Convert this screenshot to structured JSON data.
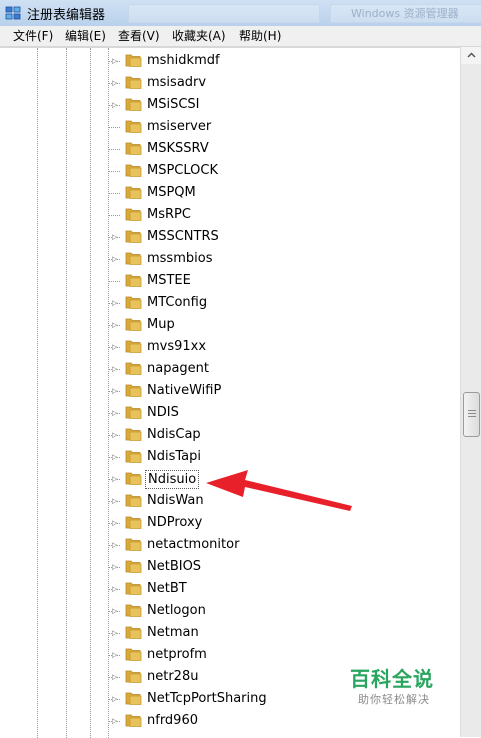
{
  "window": {
    "title": "注册表编辑器",
    "background_tabs": [
      "",
      "Windows 资源管理器"
    ]
  },
  "menu": [
    {
      "label": "文件(F)",
      "name": "menu-file"
    },
    {
      "label": "编辑(E)",
      "name": "menu-edit"
    },
    {
      "label": "查看(V)",
      "name": "menu-view"
    },
    {
      "label": "收藏夹(A)",
      "name": "menu-favorites"
    },
    {
      "label": "帮助(H)",
      "name": "menu-help"
    }
  ],
  "tree": {
    "items": [
      {
        "label": "mshidkmdf",
        "expandable": true
      },
      {
        "label": "msisadrv",
        "expandable": true
      },
      {
        "label": "MSiSCSI",
        "expandable": true
      },
      {
        "label": "msiserver",
        "expandable": false
      },
      {
        "label": "MSKSSRV",
        "expandable": false
      },
      {
        "label": "MSPCLOCK",
        "expandable": false
      },
      {
        "label": "MSPQM",
        "expandable": false
      },
      {
        "label": "MsRPC",
        "expandable": false
      },
      {
        "label": "MSSCNTRS",
        "expandable": true
      },
      {
        "label": "mssmbios",
        "expandable": true
      },
      {
        "label": "MSTEE",
        "expandable": false
      },
      {
        "label": "MTConfig",
        "expandable": true
      },
      {
        "label": "Mup",
        "expandable": true
      },
      {
        "label": "mvs91xx",
        "expandable": true
      },
      {
        "label": "napagent",
        "expandable": true
      },
      {
        "label": "NativeWifiP",
        "expandable": true
      },
      {
        "label": "NDIS",
        "expandable": true
      },
      {
        "label": "NdisCap",
        "expandable": true
      },
      {
        "label": "NdisTapi",
        "expandable": true
      },
      {
        "label": "Ndisuio",
        "expandable": true,
        "selected": true
      },
      {
        "label": "NdisWan",
        "expandable": true
      },
      {
        "label": "NDProxy",
        "expandable": true
      },
      {
        "label": "netactmonitor",
        "expandable": true
      },
      {
        "label": "NetBIOS",
        "expandable": true
      },
      {
        "label": "NetBT",
        "expandable": true
      },
      {
        "label": "Netlogon",
        "expandable": true
      },
      {
        "label": "Netman",
        "expandable": true
      },
      {
        "label": "netprofm",
        "expandable": true
      },
      {
        "label": "netr28u",
        "expandable": true
      },
      {
        "label": "NetTcpPortSharing",
        "expandable": true
      },
      {
        "label": "nfrd960",
        "expandable": true
      }
    ]
  },
  "annotation": {
    "color": "#e8202a",
    "points_to": "Ndisuio"
  },
  "watermark": {
    "main": "百科全说",
    "sub": "助你轻松解决"
  },
  "colors": {
    "folder": "#e8c25a",
    "accent_green": "#2aa55f"
  }
}
